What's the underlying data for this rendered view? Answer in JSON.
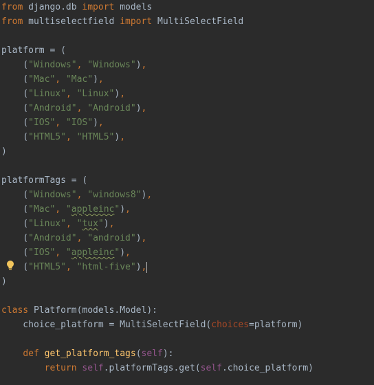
{
  "editor": {
    "lines": [
      [
        {
          "t": "from",
          "c": "kw"
        },
        {
          "t": " django.db ",
          "c": "plain"
        },
        {
          "t": "import",
          "c": "kw"
        },
        {
          "t": " models",
          "c": "plain"
        }
      ],
      [
        {
          "t": "from",
          "c": "kw"
        },
        {
          "t": " multiselectfield ",
          "c": "plain"
        },
        {
          "t": "import",
          "c": "kw"
        },
        {
          "t": " MultiSelectField",
          "c": "plain"
        }
      ],
      [],
      [
        {
          "t": "platform = (",
          "c": "plain"
        }
      ],
      [
        {
          "t": "    (",
          "c": "plain"
        },
        {
          "t": "\"Windows\"",
          "c": "str"
        },
        {
          "t": ", ",
          "c": "kw"
        },
        {
          "t": "\"Windows\"",
          "c": "str"
        },
        {
          "t": ")",
          "c": "plain"
        },
        {
          "t": ",",
          "c": "kw"
        }
      ],
      [
        {
          "t": "    (",
          "c": "plain"
        },
        {
          "t": "\"Mac\"",
          "c": "str"
        },
        {
          "t": ", ",
          "c": "kw"
        },
        {
          "t": "\"Mac\"",
          "c": "str"
        },
        {
          "t": ")",
          "c": "plain"
        },
        {
          "t": ",",
          "c": "kw"
        }
      ],
      [
        {
          "t": "    (",
          "c": "plain"
        },
        {
          "t": "\"Linux\"",
          "c": "str"
        },
        {
          "t": ", ",
          "c": "kw"
        },
        {
          "t": "\"Linux\"",
          "c": "str"
        },
        {
          "t": ")",
          "c": "plain"
        },
        {
          "t": ",",
          "c": "kw"
        }
      ],
      [
        {
          "t": "    (",
          "c": "plain"
        },
        {
          "t": "\"Android\"",
          "c": "str"
        },
        {
          "t": ", ",
          "c": "kw"
        },
        {
          "t": "\"Android\"",
          "c": "str"
        },
        {
          "t": ")",
          "c": "plain"
        },
        {
          "t": ",",
          "c": "kw"
        }
      ],
      [
        {
          "t": "    (",
          "c": "plain"
        },
        {
          "t": "\"IOS\"",
          "c": "str"
        },
        {
          "t": ", ",
          "c": "kw"
        },
        {
          "t": "\"IOS\"",
          "c": "str"
        },
        {
          "t": ")",
          "c": "plain"
        },
        {
          "t": ",",
          "c": "kw"
        }
      ],
      [
        {
          "t": "    (",
          "c": "plain"
        },
        {
          "t": "\"HTML5\"",
          "c": "str"
        },
        {
          "t": ", ",
          "c": "kw"
        },
        {
          "t": "\"HTML5\"",
          "c": "str"
        },
        {
          "t": ")",
          "c": "plain"
        },
        {
          "t": ",",
          "c": "kw"
        }
      ],
      [
        {
          "t": ")",
          "c": "plain"
        }
      ],
      [],
      [
        {
          "t": "platformTags = (",
          "c": "plain"
        }
      ],
      [
        {
          "t": "    (",
          "c": "plain"
        },
        {
          "t": "\"Windows\"",
          "c": "str"
        },
        {
          "t": ", ",
          "c": "kw"
        },
        {
          "t": "\"windows8\"",
          "c": "str"
        },
        {
          "t": ")",
          "c": "plain"
        },
        {
          "t": ",",
          "c": "kw"
        }
      ],
      [
        {
          "t": "    (",
          "c": "plain"
        },
        {
          "t": "\"Mac\"",
          "c": "str"
        },
        {
          "t": ", ",
          "c": "kw"
        },
        {
          "t": "\"",
          "c": "str"
        },
        {
          "t": "appleinc",
          "c": "str typo"
        },
        {
          "t": "\"",
          "c": "str"
        },
        {
          "t": ")",
          "c": "plain"
        },
        {
          "t": ",",
          "c": "kw"
        }
      ],
      [
        {
          "t": "    (",
          "c": "plain"
        },
        {
          "t": "\"Linux\"",
          "c": "str"
        },
        {
          "t": ", ",
          "c": "kw"
        },
        {
          "t": "\"",
          "c": "str"
        },
        {
          "t": "tux",
          "c": "str typo"
        },
        {
          "t": "\"",
          "c": "str"
        },
        {
          "t": ")",
          "c": "plain"
        },
        {
          "t": ",",
          "c": "kw"
        }
      ],
      [
        {
          "t": "    (",
          "c": "plain"
        },
        {
          "t": "\"Android\"",
          "c": "str"
        },
        {
          "t": ", ",
          "c": "kw"
        },
        {
          "t": "\"android\"",
          "c": "str"
        },
        {
          "t": ")",
          "c": "plain"
        },
        {
          "t": ",",
          "c": "kw"
        }
      ],
      [
        {
          "t": "    (",
          "c": "plain"
        },
        {
          "t": "\"IOS\"",
          "c": "str"
        },
        {
          "t": ", ",
          "c": "kw"
        },
        {
          "t": "\"",
          "c": "str"
        },
        {
          "t": "appleinc",
          "c": "str typo"
        },
        {
          "t": "\"",
          "c": "str"
        },
        {
          "t": ")",
          "c": "plain"
        },
        {
          "t": ",",
          "c": "kw"
        }
      ],
      [
        {
          "t": "    (",
          "c": "plain"
        },
        {
          "t": "\"HTML5\"",
          "c": "str"
        },
        {
          "t": ", ",
          "c": "kw"
        },
        {
          "t": "\"html-five\"",
          "c": "str"
        },
        {
          "t": ")",
          "c": "plain"
        },
        {
          "t": ",",
          "c": "kw"
        },
        {
          "caret": true
        }
      ],
      [
        {
          "t": ")",
          "c": "plain"
        }
      ],
      [],
      [
        {
          "t": "class",
          "c": "kw"
        },
        {
          "t": " Platform(models.Model):",
          "c": "plain"
        }
      ],
      [
        {
          "t": "    choice_platform = MultiSelectField(",
          "c": "plain"
        },
        {
          "t": "choices",
          "c": "param"
        },
        {
          "t": "=platform)",
          "c": "plain"
        }
      ],
      [],
      [
        {
          "t": "    ",
          "c": "plain"
        },
        {
          "t": "def",
          "c": "kw"
        },
        {
          "t": " ",
          "c": "plain"
        },
        {
          "t": "get_platform_tags",
          "c": "fn"
        },
        {
          "t": "(",
          "c": "plain"
        },
        {
          "t": "self",
          "c": "self"
        },
        {
          "t": "):",
          "c": "plain"
        }
      ],
      [
        {
          "t": "        ",
          "c": "plain"
        },
        {
          "t": "return",
          "c": "kw"
        },
        {
          "t": " ",
          "c": "plain"
        },
        {
          "t": "self",
          "c": "self"
        },
        {
          "t": ".platformTags.get(",
          "c": "plain"
        },
        {
          "t": "self",
          "c": "self"
        },
        {
          "t": ".choice_platform)",
          "c": "plain"
        }
      ]
    ],
    "gutter_icon": "intention-bulb-icon"
  }
}
